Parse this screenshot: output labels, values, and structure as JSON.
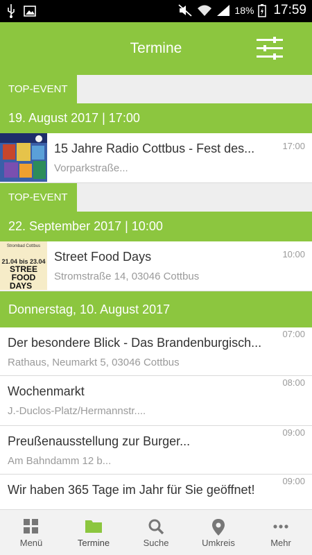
{
  "status_bar": {
    "battery": "18%",
    "time": "17:59"
  },
  "header": {
    "title": "Termine"
  },
  "top_events": [
    {
      "badge": "TOP-EVENT",
      "date": "19. August 2017 | 17:00",
      "title": "15 Jahre Radio Cottbus - Fest des...",
      "location": "Vorparkstraße...",
      "time": "17:00"
    },
    {
      "badge": "TOP-EVENT",
      "date": "22. September 2017 | 10:00",
      "title": "Street Food Days",
      "location": "Stromstraße 14, 03046 Cottbus",
      "time": "10:00",
      "poster": {
        "line1": "Strombad Cottbus",
        "dates": "21.04 bis 23.04",
        "big1": "STREE",
        "big2": "FOOD",
        "big3": "DAYS"
      }
    }
  ],
  "day_section": {
    "date": "Donnerstag, 10. August 2017",
    "events": [
      {
        "title": "Der besondere Blick - Das Brandenburgisch...",
        "location": "Rathaus, Neumarkt 5, 03046 Cottbus",
        "time": "07:00"
      },
      {
        "title": "Wochenmarkt",
        "location": "J.-Duclos-Platz/Hermannstr....",
        "time": "08:00"
      },
      {
        "title": "Preußenausstellung zur Burger...",
        "location": "Am Bahndamm 12 b...",
        "time": "09:00"
      },
      {
        "title": "Wir haben 365 Tage im Jahr für Sie geöffnet!",
        "location": "",
        "time": "09:00"
      }
    ]
  },
  "bottom_nav": [
    {
      "label": "Menü",
      "icon": "grid-icon",
      "active": false
    },
    {
      "label": "Termine",
      "icon": "folder-icon",
      "active": true
    },
    {
      "label": "Suche",
      "icon": "search-icon",
      "active": false
    },
    {
      "label": "Umkreis",
      "icon": "location-pin-icon",
      "active": false
    },
    {
      "label": "Mehr",
      "icon": "more-dots-icon",
      "active": false
    }
  ],
  "colors": {
    "accent": "#8cc63f",
    "status_bar": "#000000",
    "list_bg": "#eeeeee",
    "muted_text": "#9a9a9a"
  }
}
